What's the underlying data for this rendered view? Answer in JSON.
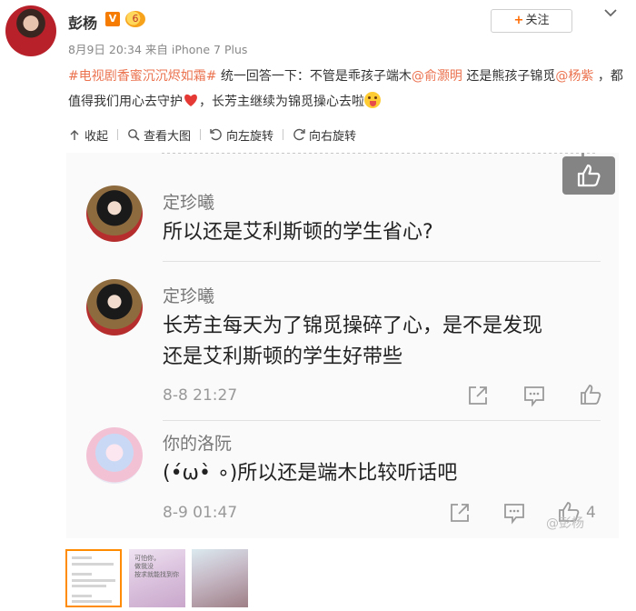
{
  "post": {
    "author": "彭杨",
    "verified_badge": "V",
    "level_badge": "6",
    "meta": "8月9日 20:34 来自 iPhone 7 Plus",
    "follow_label": "关注",
    "text_topic": "#电视剧香蜜沉沉烬如霜#",
    "text_1": " 统一回答一下：不管是乖孩子端木",
    "mention_1": "@俞灏明",
    "text_2": " 还是熊孩子锦觅",
    "mention_2": "@杨紫",
    "text_3": " ，都值得我们用心去守护",
    "text_4": "，长芳主继续为锦觅操心去啦"
  },
  "toolbar": {
    "collapse": "收起",
    "view_large": "查看大图",
    "rotate_left": "向左旋转",
    "rotate_right": "向右旋转"
  },
  "image": {
    "comments": [
      {
        "user": "定珍曦",
        "text": "所以还是艾利斯顿的学生省心?"
      },
      {
        "user": "定珍曦",
        "line1": "长芳主每天为了锦觅操碎了心，是不是发现",
        "line2": "还是艾利斯顿的学生好带些",
        "time": "8-8 21:27"
      },
      {
        "user": "你的洛阮",
        "text": "(•́ω•̀ ∘)所以还是端木比较听话吧",
        "time": "8-9 01:47",
        "likes": "4"
      }
    ],
    "watermark": "@彭杨"
  },
  "thumbnails": {
    "t2_text": "可怕你，\n做我没\n按求就能找到你"
  },
  "colors": {
    "link": "#eb7350",
    "accent_orange": "#ff8c00"
  }
}
